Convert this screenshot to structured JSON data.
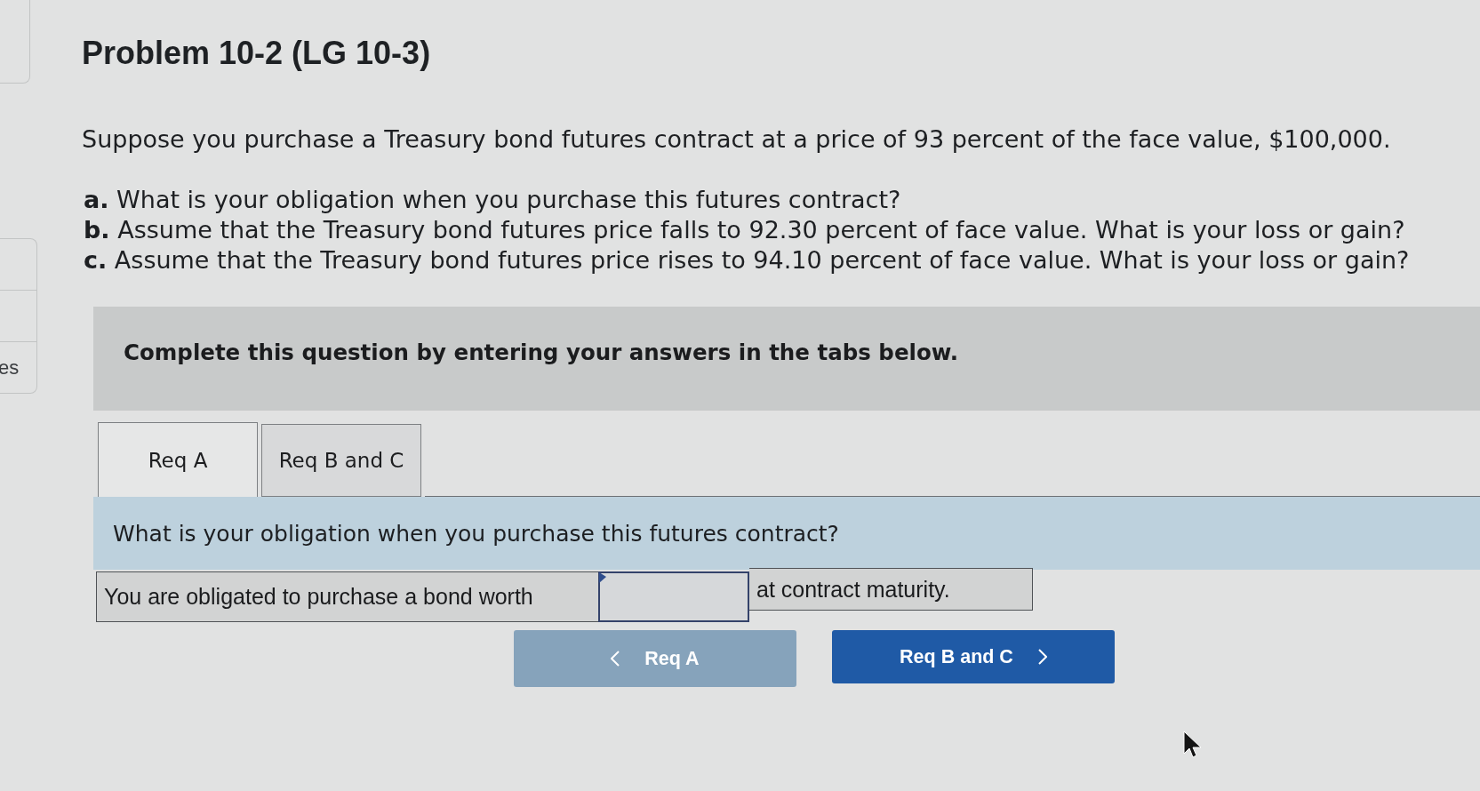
{
  "sidebar": {
    "label": "es"
  },
  "problem": {
    "title": "Problem 10-2 (LG 10-3)",
    "intro": "Suppose you purchase a Treasury bond futures contract at a price of 93 percent of the face value, $100,000.",
    "parts": [
      "**a.** What is your obligation when you purchase this futures contract?",
      "**b.** Assume that the Treasury bond futures price falls to 92.30 percent of face value. What is your loss or gain?",
      "**c.** Assume that the Treasury bond futures price rises to 94.10 percent of face value. What is your loss or gain?"
    ]
  },
  "instructions": "Complete this question by entering your answers in the tabs below.",
  "tabs": [
    {
      "label": "Req A",
      "selected": true
    },
    {
      "label": "Req B and C",
      "selected": false
    }
  ],
  "question": "What is your obligation when you purchase this futures contract?",
  "answer_row": {
    "prompt": "You are obligated to purchase a bond worth",
    "suffix": "at contract maturity."
  },
  "nav_buttons": [
    {
      "kind": "previous",
      "label": "Req A",
      "disabled": true
    },
    {
      "kind": "next",
      "label": "Req B and C",
      "disabled": false
    }
  ]
}
